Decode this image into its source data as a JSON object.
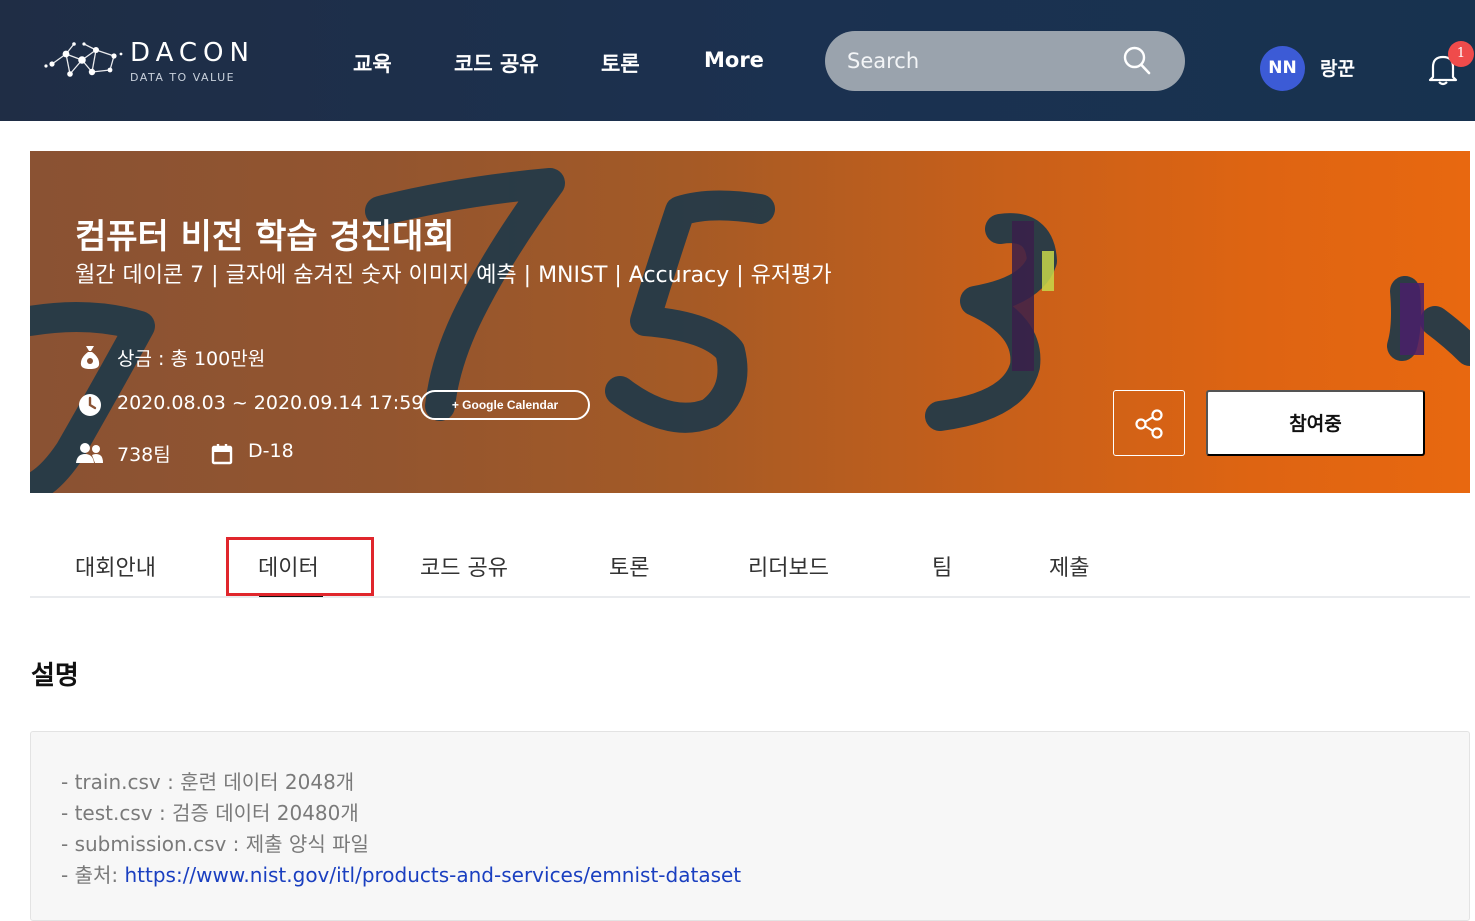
{
  "header": {
    "logo": {
      "wordmark": "DACON",
      "tagline": "DATA TO VALUE"
    },
    "nav": [
      {
        "label": "교육"
      },
      {
        "label": "코드 공유"
      },
      {
        "label": "토론"
      },
      {
        "label": "More"
      }
    ],
    "search": {
      "placeholder": "Search",
      "icon": "search-icon"
    },
    "user": {
      "initials": "NN",
      "name": "랑꾼",
      "avatar_color": "#3c5bd6"
    },
    "notifications": {
      "count": "1",
      "icon": "bell-icon"
    }
  },
  "banner": {
    "title": "컴퓨터 비전 학습 경진대회",
    "subtitle": "월간 데이콘 7 | 글자에 숨겨진 숫자 이미지 예측 | MNIST | Accuracy | 유저평가",
    "prize": "상금 : 총 100만원",
    "period": "2020.08.03 ~ 2020.09.14 17:59",
    "calendar_button": "+ Google Calendar",
    "teams": "738팀",
    "dday": "D-18",
    "share_icon": "share-icon",
    "join_button": "참여중"
  },
  "tabs": [
    {
      "label": "대회안내"
    },
    {
      "label": "데이터",
      "active": true
    },
    {
      "label": "코드 공유"
    },
    {
      "label": "토론"
    },
    {
      "label": "리더보드"
    },
    {
      "label": "팀"
    },
    {
      "label": "제출"
    }
  ],
  "content": {
    "section_title": "설명",
    "lines": [
      "- train.csv : 훈련 데이터 2048개",
      "- test.csv : 검증 데이터 20480개",
      "- submission.csv : 제출 양식 파일"
    ],
    "source_prefix": "- 출처: ",
    "source_link": "https://www.nist.gov/itl/products-and-services/emnist-dataset"
  },
  "colors": {
    "header_bg": "#1f2d45",
    "highlight_box": "#e0262c",
    "link": "#1a3fc0"
  }
}
